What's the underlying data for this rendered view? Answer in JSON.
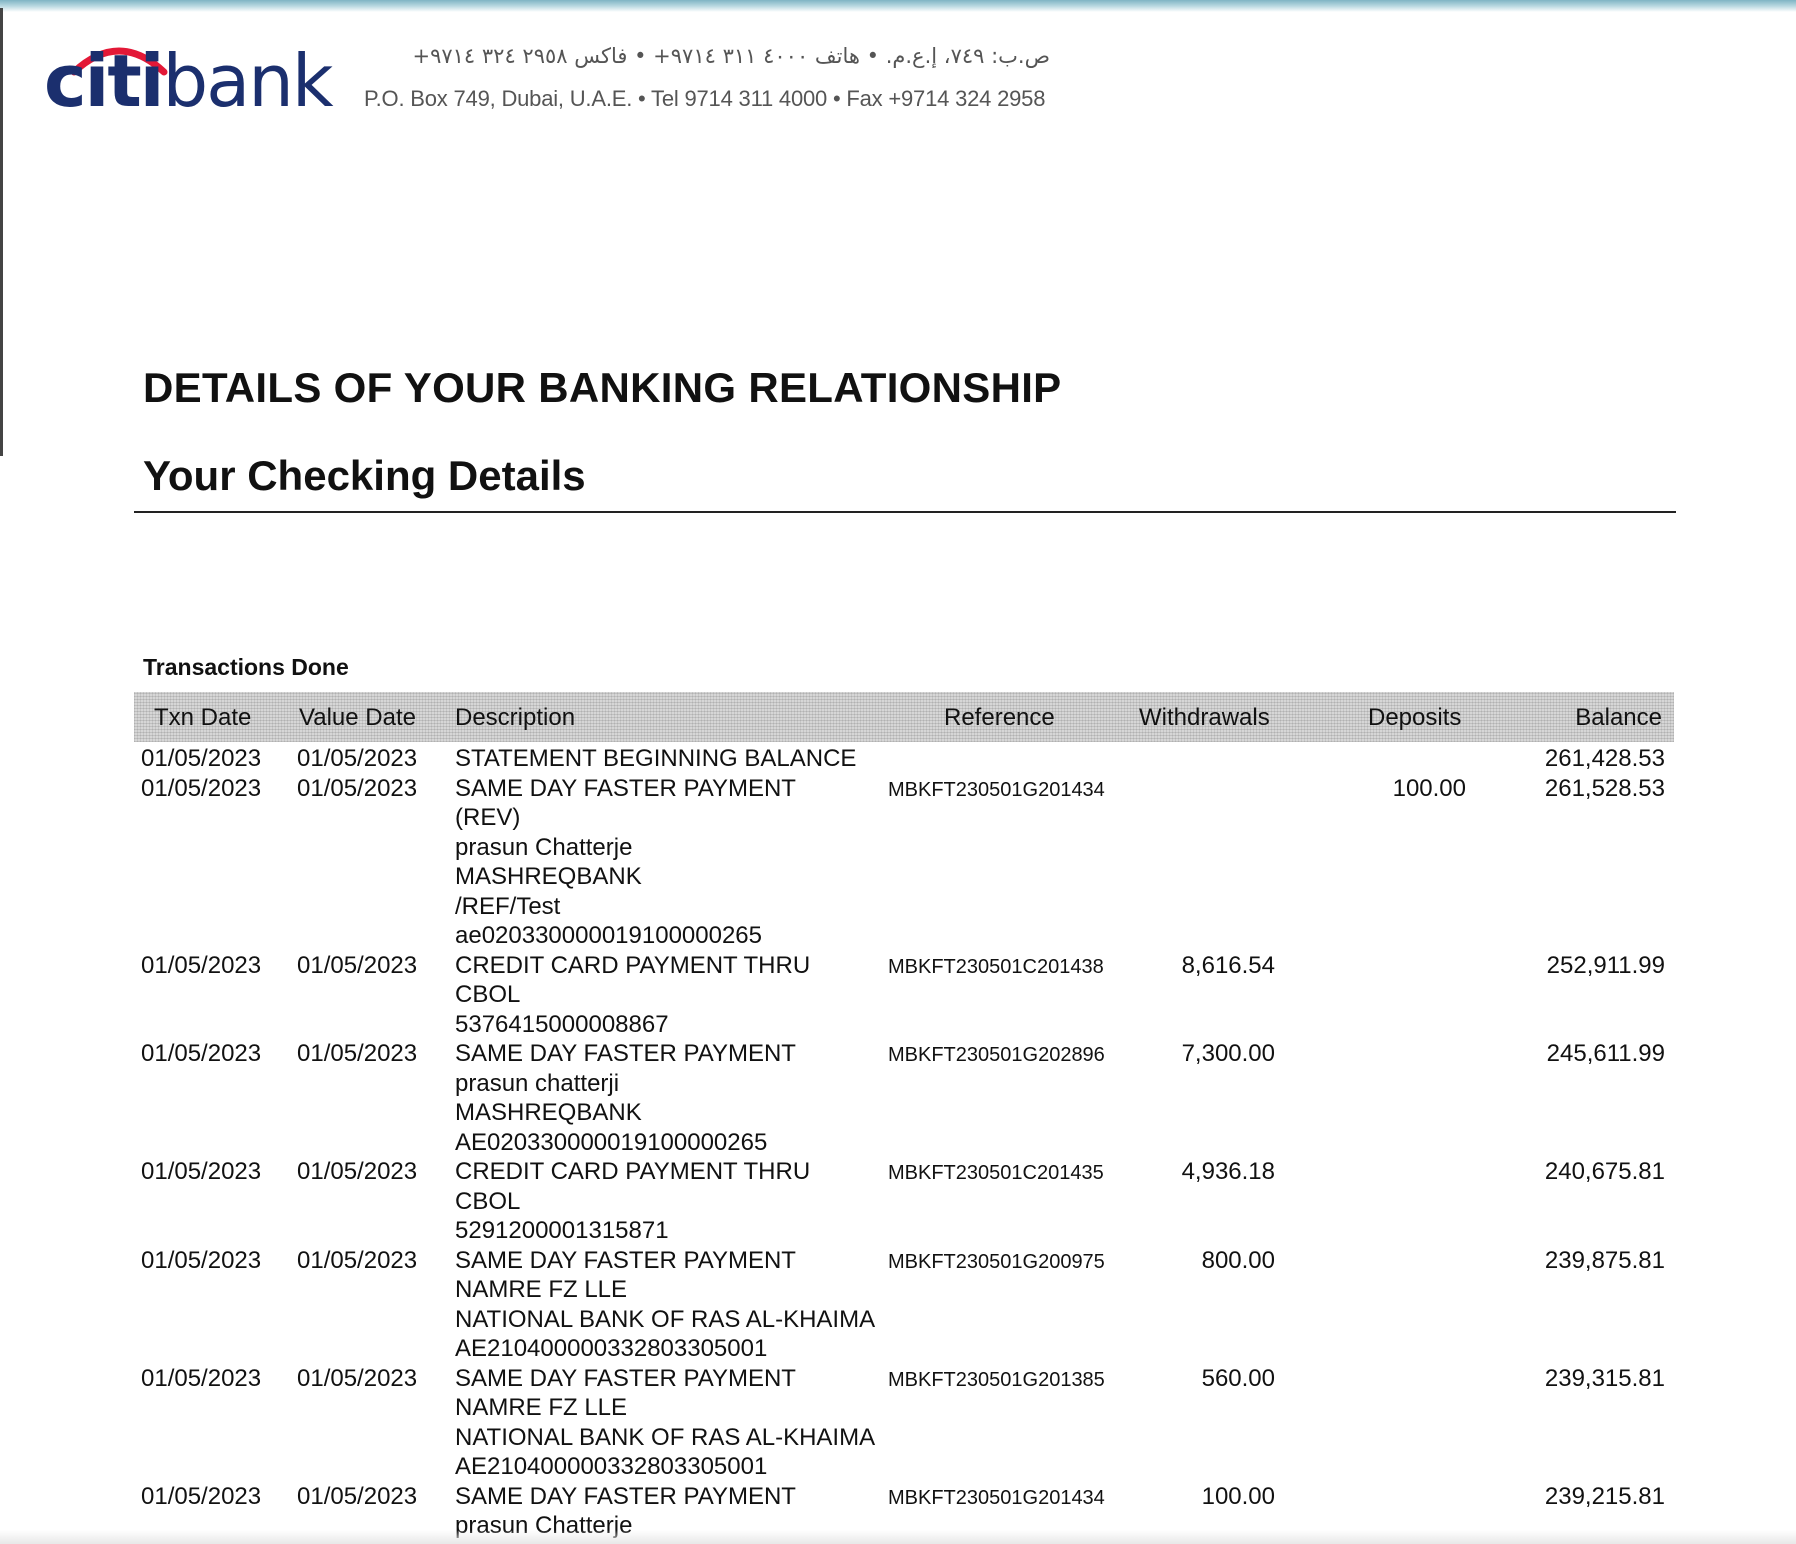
{
  "header": {
    "logo": "citibank",
    "address_ar": "ص.ب: ٧٤٩، إ.ع.م. • هاتف ٤٠٠٠ ٣١١ ٩٧١٤+ • فاكس ٢٩٥٨ ٣٢٤ ٩٧١٤+",
    "address_en": "P.O. Box  749, Dubai, U.A.E. • Tel 9714 311 4000 • Fax +9714 324 2958"
  },
  "title": "DETAILS OF YOUR BANKING RELATIONSHIP",
  "subtitle": "Your Checking Details",
  "section_label": "Transactions Done",
  "columns": {
    "txn_date": "Txn Date",
    "value_date": "Value Date",
    "description": "Description",
    "reference": "Reference",
    "withdrawals": "Withdrawals",
    "deposits": "Deposits",
    "balance": "Balance"
  },
  "transactions": [
    {
      "txn_date": "01/05/2023",
      "value_date": "01/05/2023",
      "description": [
        "STATEMENT BEGINNING BALANCE"
      ],
      "reference": "",
      "withdrawal": "",
      "deposit": "",
      "balance": "261,428.53"
    },
    {
      "txn_date": "01/05/2023",
      "value_date": "01/05/2023",
      "description": [
        "SAME DAY FASTER PAYMENT",
        "(REV)",
        "prasun Chatterje",
        "MASHREQBANK",
        "/REF/Test",
        "ae020330000019100000265"
      ],
      "reference": "MBKFT230501G201434",
      "withdrawal": "",
      "deposit": "100.00",
      "balance": "261,528.53"
    },
    {
      "txn_date": "01/05/2023",
      "value_date": "01/05/2023",
      "description": [
        "CREDIT CARD PAYMENT THRU",
        "CBOL",
        "5376415000008867"
      ],
      "reference": "MBKFT230501C201438",
      "withdrawal": "8,616.54",
      "deposit": "",
      "balance": "252,911.99"
    },
    {
      "txn_date": "01/05/2023",
      "value_date": "01/05/2023",
      "description": [
        "SAME DAY FASTER PAYMENT",
        "prasun chatterji",
        "MASHREQBANK",
        "AE020330000019100000265"
      ],
      "reference": "MBKFT230501G202896",
      "withdrawal": "7,300.00",
      "deposit": "",
      "balance": "245,611.99"
    },
    {
      "txn_date": "01/05/2023",
      "value_date": "01/05/2023",
      "description": [
        "CREDIT CARD PAYMENT THRU",
        "CBOL",
        "5291200001315871"
      ],
      "reference": "MBKFT230501C201435",
      "withdrawal": "4,936.18",
      "deposit": "",
      "balance": "240,675.81"
    },
    {
      "txn_date": "01/05/2023",
      "value_date": "01/05/2023",
      "description": [
        "SAME DAY FASTER PAYMENT",
        "NAMRE FZ LLE",
        "NATIONAL BANK OF RAS AL-KHAIMA",
        "AE210400000332803305001"
      ],
      "reference": "MBKFT230501G200975",
      "withdrawal": "800.00",
      "deposit": "",
      "balance": "239,875.81"
    },
    {
      "txn_date": "01/05/2023",
      "value_date": "01/05/2023",
      "description": [
        "SAME DAY FASTER PAYMENT",
        "NAMRE FZ LLE",
        "NATIONAL BANK OF RAS AL-KHAIMA",
        "AE210400000332803305001"
      ],
      "reference": "MBKFT230501G201385",
      "withdrawal": "560.00",
      "deposit": "",
      "balance": "239,315.81"
    },
    {
      "txn_date": "01/05/2023",
      "value_date": "01/05/2023",
      "description": [
        "SAME DAY FASTER PAYMENT",
        "prasun Chatterje"
      ],
      "reference": "MBKFT230501G201434",
      "withdrawal": "100.00",
      "deposit": "",
      "balance": "239,215.81"
    }
  ]
}
